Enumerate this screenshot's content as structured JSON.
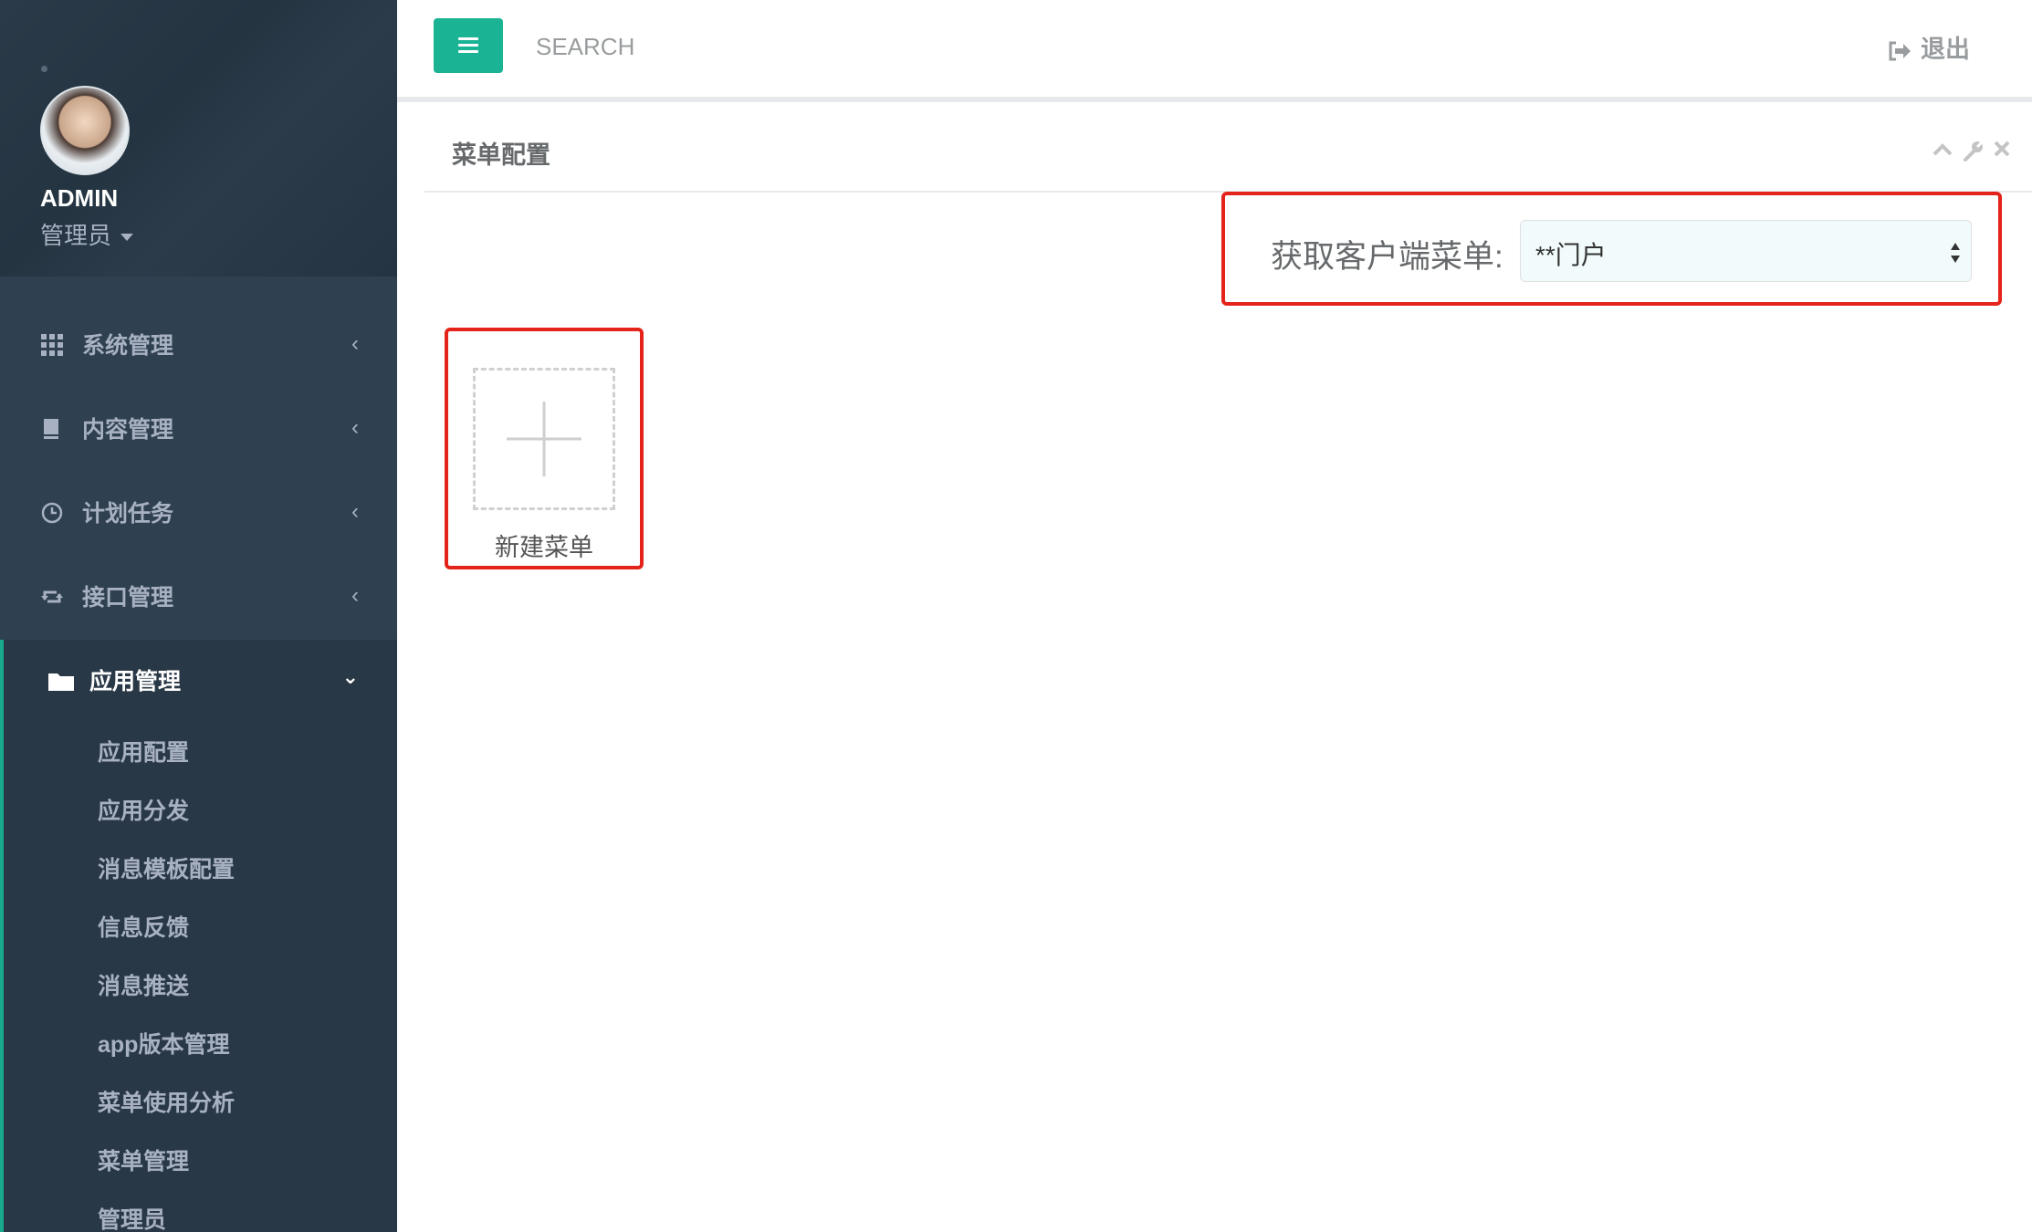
{
  "sidebar": {
    "profile": {
      "name": "ADMIN",
      "role": "管理员"
    },
    "items": [
      {
        "label": "系统管理",
        "icon": "grid-icon"
      },
      {
        "label": "内容管理",
        "icon": "book-icon"
      },
      {
        "label": "计划任务",
        "icon": "clock-icon"
      },
      {
        "label": "接口管理",
        "icon": "retweet-icon"
      }
    ],
    "active": {
      "label": "应用管理",
      "icon": "folder-icon",
      "children": [
        "应用配置",
        "应用分发",
        "消息模板配置",
        "信息反馈",
        "消息推送",
        "app版本管理",
        "菜单使用分析",
        "菜单管理",
        "管理员"
      ]
    }
  },
  "topbar": {
    "search_placeholder": "SEARCH",
    "logout_label": "退出"
  },
  "panel": {
    "title": "菜单配置",
    "select_label": "获取客户端菜单:",
    "select_value": "**门户",
    "new_menu_label": "新建菜单"
  },
  "colors": {
    "sidebar_bg": "#2f4050",
    "accent": "#1ab394",
    "highlight": "#e4231a"
  }
}
